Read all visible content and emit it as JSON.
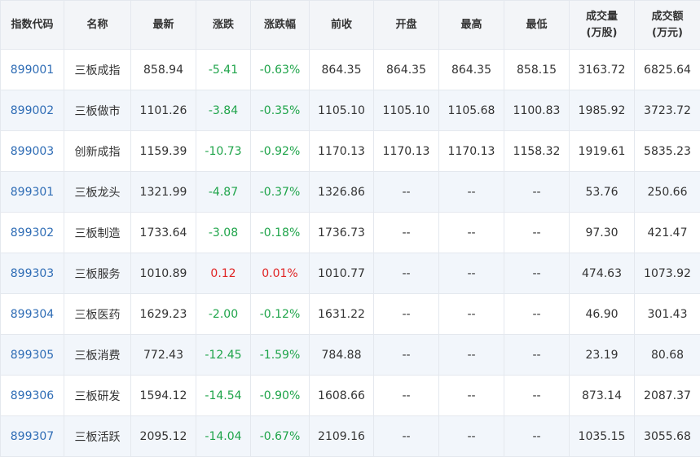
{
  "colors": {
    "up": "#e02424",
    "down": "#1fa44a",
    "code_link": "#2e6cb5",
    "header_bg": "#f3f5f8",
    "stripe_bg": "#f2f6fb"
  },
  "headers": [
    "指数代码",
    "名称",
    "最新",
    "涨跌",
    "涨跌幅",
    "前收",
    "开盘",
    "最高",
    "最低",
    "成交量\n(万股)",
    "成交额\n(万元)"
  ],
  "rows": [
    {
      "code": "899001",
      "name": "三板成指",
      "last": "858.94",
      "chg": "-5.41",
      "pct": "-0.63%",
      "prev": "864.35",
      "open": "864.35",
      "high": "864.35",
      "low": "858.15",
      "vol": "3163.72",
      "amt": "6825.64",
      "dir": "down"
    },
    {
      "code": "899002",
      "name": "三板做市",
      "last": "1101.26",
      "chg": "-3.84",
      "pct": "-0.35%",
      "prev": "1105.10",
      "open": "1105.10",
      "high": "1105.68",
      "low": "1100.83",
      "vol": "1985.92",
      "amt": "3723.72",
      "dir": "down"
    },
    {
      "code": "899003",
      "name": "创新成指",
      "last": "1159.39",
      "chg": "-10.73",
      "pct": "-0.92%",
      "prev": "1170.13",
      "open": "1170.13",
      "high": "1170.13",
      "low": "1158.32",
      "vol": "1919.61",
      "amt": "5835.23",
      "dir": "down"
    },
    {
      "code": "899301",
      "name": "三板龙头",
      "last": "1321.99",
      "chg": "-4.87",
      "pct": "-0.37%",
      "prev": "1326.86",
      "open": "--",
      "high": "--",
      "low": "--",
      "vol": "53.76",
      "amt": "250.66",
      "dir": "down"
    },
    {
      "code": "899302",
      "name": "三板制造",
      "last": "1733.64",
      "chg": "-3.08",
      "pct": "-0.18%",
      "prev": "1736.73",
      "open": "--",
      "high": "--",
      "low": "--",
      "vol": "97.30",
      "amt": "421.47",
      "dir": "down"
    },
    {
      "code": "899303",
      "name": "三板服务",
      "last": "1010.89",
      "chg": "0.12",
      "pct": "0.01%",
      "prev": "1010.77",
      "open": "--",
      "high": "--",
      "low": "--",
      "vol": "474.63",
      "amt": "1073.92",
      "dir": "up"
    },
    {
      "code": "899304",
      "name": "三板医药",
      "last": "1629.23",
      "chg": "-2.00",
      "pct": "-0.12%",
      "prev": "1631.22",
      "open": "--",
      "high": "--",
      "low": "--",
      "vol": "46.90",
      "amt": "301.43",
      "dir": "down"
    },
    {
      "code": "899305",
      "name": "三板消费",
      "last": "772.43",
      "chg": "-12.45",
      "pct": "-1.59%",
      "prev": "784.88",
      "open": "--",
      "high": "--",
      "low": "--",
      "vol": "23.19",
      "amt": "80.68",
      "dir": "down"
    },
    {
      "code": "899306",
      "name": "三板研发",
      "last": "1594.12",
      "chg": "-14.54",
      "pct": "-0.90%",
      "prev": "1608.66",
      "open": "--",
      "high": "--",
      "low": "--",
      "vol": "873.14",
      "amt": "2087.37",
      "dir": "down"
    },
    {
      "code": "899307",
      "name": "三板活跃",
      "last": "2095.12",
      "chg": "-14.04",
      "pct": "-0.67%",
      "prev": "2109.16",
      "open": "--",
      "high": "--",
      "low": "--",
      "vol": "1035.15",
      "amt": "3055.68",
      "dir": "down"
    }
  ]
}
